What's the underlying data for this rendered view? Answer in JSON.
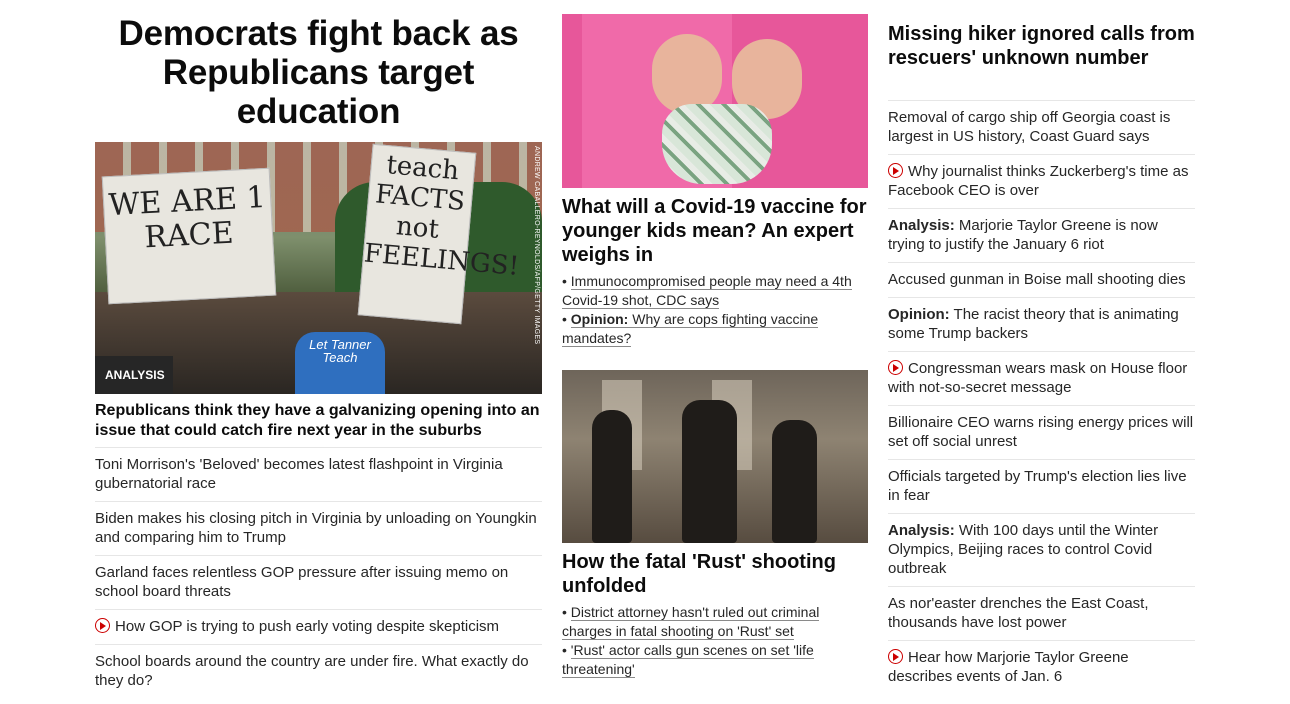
{
  "col1": {
    "headline": "Democrats fight back as Republicans target education",
    "hero": {
      "badge": "ANALYSIS",
      "credit": "ANDREW CABALLERO-REYNOLDS/AFP/GETTY IMAGES",
      "sign1": "WE ARE 1 RACE",
      "sign2": "teach FACTS not FEELINGS!",
      "shirt": "Let Tanner Teach"
    },
    "hero_link": "Republicans think they have a galvanizing opening into an issue that could catch fire next year in the suburbs",
    "items": [
      {
        "text": "Toni Morrison's 'Beloved' becomes latest flashpoint in Virginia gubernatorial race"
      },
      {
        "text": "Biden makes his closing pitch in Virginia by unloading on Youngkin and comparing him to Trump"
      },
      {
        "text": "Garland faces relentless GOP pressure after issuing memo on school board threats"
      },
      {
        "text": "How GOP is trying to push early voting despite skepticism",
        "video": true
      },
      {
        "text": "School boards around the country are under fire. What exactly do they do?"
      }
    ]
  },
  "col2": {
    "story1": {
      "headline": "What will a Covid-19 vaccine for younger kids mean? An expert weighs in",
      "bullets": [
        {
          "kicker": "",
          "text": "Immunocompromised people may need a 4th Covid-19 shot, CDC says"
        },
        {
          "kicker": "Opinion:",
          "text": " Why are cops fighting vaccine mandates?"
        }
      ]
    },
    "story2": {
      "headline": "How the fatal 'Rust' shooting unfolded",
      "bullets": [
        {
          "kicker": "",
          "text": "District attorney hasn't ruled out criminal charges in fatal shooting on 'Rust' set"
        },
        {
          "kicker": "",
          "text": "'Rust' actor calls gun scenes on set 'life threatening'"
        }
      ]
    }
  },
  "col3": {
    "headline": "Missing hiker ignored calls from rescuers' unknown number",
    "items": [
      {
        "kicker": "",
        "text": "Removal of cargo ship off Georgia coast is largest in US history, Coast Guard says"
      },
      {
        "kicker": "",
        "text": "Why journalist thinks Zuckerberg's time as Facebook CEO is over",
        "video": true
      },
      {
        "kicker": "Analysis:",
        "text": " Marjorie Taylor Greene is now trying to justify the January 6 riot"
      },
      {
        "kicker": "",
        "text": "Accused gunman in Boise mall shooting dies"
      },
      {
        "kicker": "Opinion:",
        "text": " The racist theory that is animating some Trump backers"
      },
      {
        "kicker": "",
        "text": "Congressman wears mask on House floor with not-so-secret message",
        "video": true
      },
      {
        "kicker": "",
        "text": "Billionaire CEO warns rising energy prices will set off social unrest"
      },
      {
        "kicker": "",
        "text": "Officials targeted by Trump's election lies live in fear"
      },
      {
        "kicker": "Analysis:",
        "text": " With 100 days until the Winter Olympics, Beijing races to control Covid outbreak"
      },
      {
        "kicker": "",
        "text": "As nor'easter drenches the East Coast, thousands have lost power"
      },
      {
        "kicker": "",
        "text": "Hear how Marjorie Taylor Greene describes events of Jan. 6",
        "video": true
      }
    ]
  },
  "colors": {
    "accent": "#cc0000",
    "badge_bg": "#262626",
    "divider": "#e6e6e6"
  }
}
